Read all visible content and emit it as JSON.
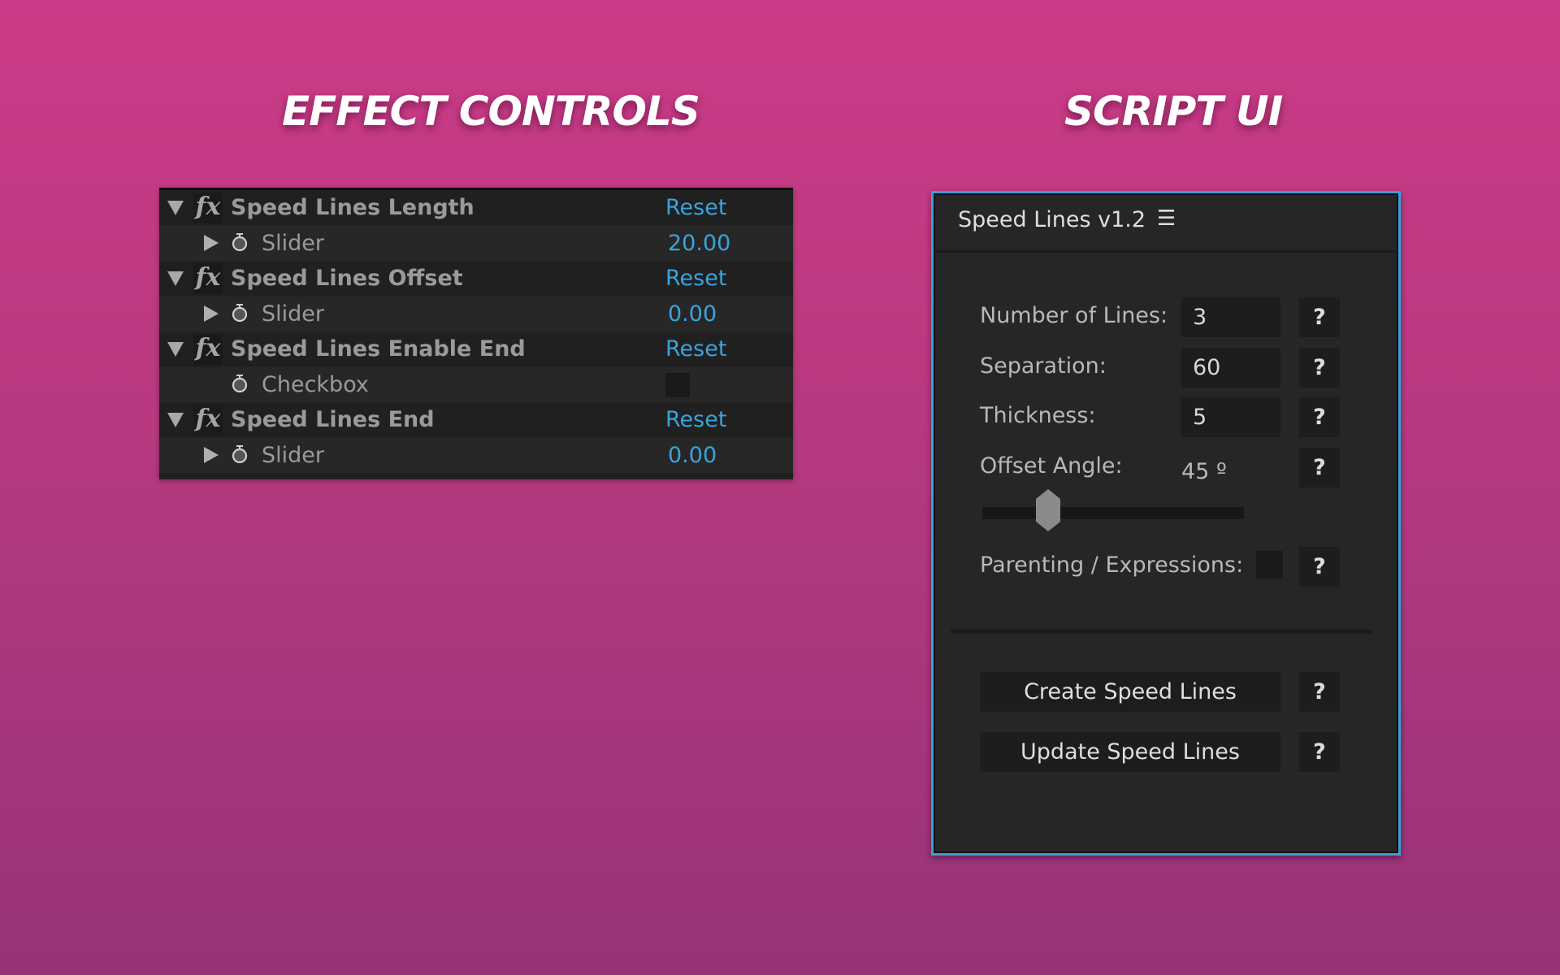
{
  "headings": {
    "left": "EFFECT CONTROLS",
    "right": "SCRIPT UI"
  },
  "effect_controls": {
    "reset_label": "Reset",
    "groups": [
      {
        "name": "Speed Lines Length",
        "param": "Slider",
        "value": "20.00",
        "type": "slider"
      },
      {
        "name": "Speed Lines Offset",
        "param": "Slider",
        "value": "0.00",
        "type": "slider"
      },
      {
        "name": "Speed Lines Enable End",
        "param": "Checkbox",
        "value": "",
        "type": "checkbox",
        "checked": false
      },
      {
        "name": "Speed Lines End",
        "param": "Slider",
        "value": "0.00",
        "type": "slider"
      }
    ],
    "fx_glyph": "fx",
    "accent_color": "#3aa3dc"
  },
  "script_ui": {
    "title": "Speed Lines v1.2",
    "menu_icon": "☰",
    "help_label": "?",
    "fields": [
      {
        "label": "Number of Lines:",
        "value": "3"
      },
      {
        "label": "Separation:",
        "value": "60"
      },
      {
        "label": "Thickness:",
        "value": "5"
      }
    ],
    "offset_angle": {
      "label": "Offset Angle:",
      "value_text": "45 º",
      "slider_fraction": 0.25
    },
    "parenting": {
      "label": "Parenting / Expressions:",
      "checked": false
    },
    "buttons": {
      "create": "Create Speed Lines",
      "update": "Update Speed Lines"
    },
    "border_color": "#3a9fd6"
  }
}
